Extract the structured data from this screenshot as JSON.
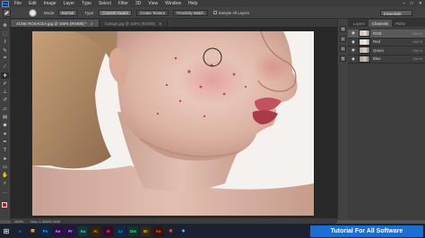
{
  "app": {
    "logo": "Ps",
    "menu": [
      "File",
      "Edit",
      "Image",
      "Layer",
      "Type",
      "Select",
      "Filter",
      "3D",
      "View",
      "Window",
      "Help"
    ],
    "window_controls": [
      "–",
      "□",
      "✕"
    ]
  },
  "options_bar": {
    "mode_label": "Mode:",
    "mode_value": "Normal",
    "type_label": "Type:",
    "type_options": [
      "Content-Aware",
      "Create Texture",
      "Proximity Match"
    ],
    "type_selected": "Content-Aware",
    "sample_all_layers": "Sample All Layers",
    "workspace": "Essentials"
  },
  "documents": [
    {
      "title": "ACNE ROSACEA.jpg @ 100% (RGB/8) *",
      "active": true
    },
    {
      "title": "footage.jpg @ 100% (RGB/8)",
      "active": false
    }
  ],
  "status_bar": {
    "zoom": "100%",
    "doc_info": "Doc: 1.04M/1.04M"
  },
  "panels": {
    "tabs": [
      "Layers",
      "Channels",
      "Paths"
    ],
    "active_tab": "Channels",
    "channels": [
      {
        "name": "RGB",
        "shortcut": "Ctrl+2",
        "thumb": "rgb"
      },
      {
        "name": "Red",
        "shortcut": "Ctrl+3",
        "thumb": "red"
      },
      {
        "name": "Green",
        "shortcut": "Ctrl+4",
        "thumb": "green"
      },
      {
        "name": "Blue",
        "shortcut": "Ctrl+5",
        "thumb": "blue"
      }
    ]
  },
  "taskbar": {
    "apps": [
      {
        "label": "e",
        "color": "#2d7fd3",
        "bg": "#1b2130"
      },
      {
        "label": "▤",
        "color": "#f0c04a",
        "bg": "#1b2130"
      },
      {
        "label": "Ps",
        "color": "#31a8ff",
        "bg": "#0b2a4a"
      },
      {
        "label": "Ae",
        "color": "#d7a2ff",
        "bg": "#2a0f4a"
      },
      {
        "label": "Pr",
        "color": "#d7a2ff",
        "bg": "#2a0f4a"
      },
      {
        "label": "Au",
        "color": "#4fe3c1",
        "bg": "#0e3a34"
      },
      {
        "label": "Ai",
        "color": "#ff9a00",
        "bg": "#3a2200"
      },
      {
        "label": "Id",
        "color": "#ff3f8e",
        "bg": "#3a0a20"
      },
      {
        "label": "Lr",
        "color": "#31a8ff",
        "bg": "#0b2a4a"
      },
      {
        "label": "Dw",
        "color": "#4ae3a0",
        "bg": "#0e3a24"
      },
      {
        "label": "Br",
        "color": "#e8b84a",
        "bg": "#3a2a0a"
      },
      {
        "label": "An",
        "color": "#ff5a3a",
        "bg": "#3a1208"
      },
      {
        "label": "◉",
        "color": "#e84a3a",
        "bg": "#1b2130"
      },
      {
        "label": "◈",
        "color": "#5ac0ff",
        "bg": "#1b2130"
      }
    ],
    "banner": "Tutorial For All Software"
  }
}
